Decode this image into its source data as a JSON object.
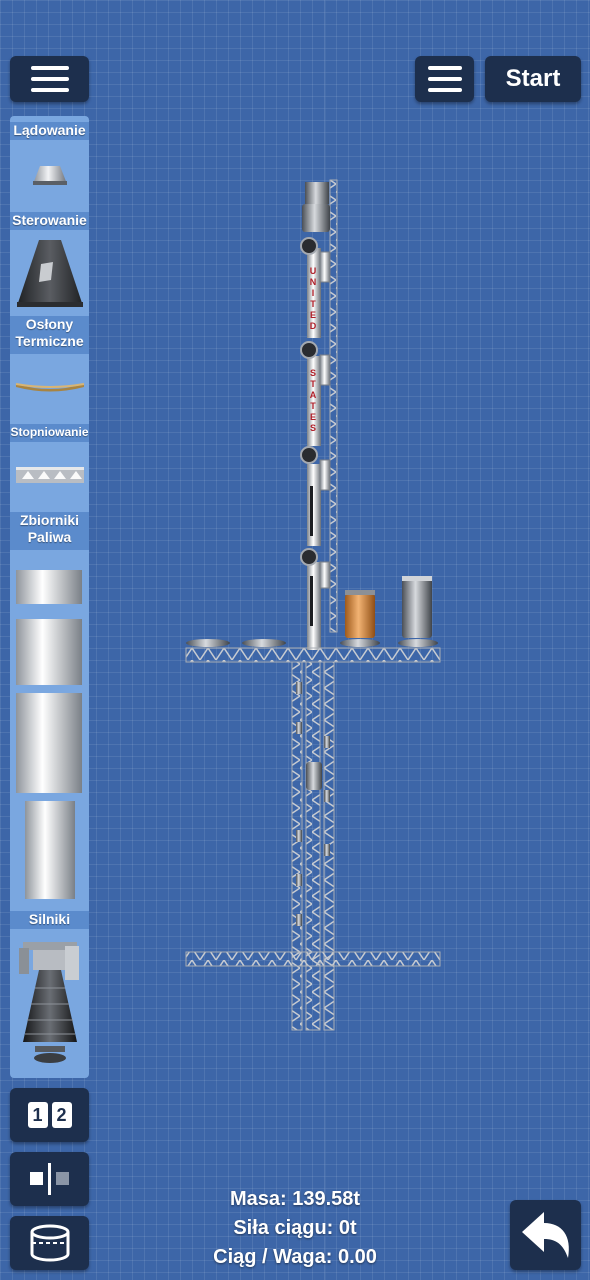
{
  "toolbar": {
    "start_label": "Start"
  },
  "categories": {
    "landing": "Lądowanie",
    "control": "Sterowanie",
    "heat_shields": "Osłony Termiczne",
    "staging": "Stopniowanie",
    "fuel_tanks": "Zbiorniki Paliwa",
    "engines": "Silniki"
  },
  "tool_buttons": {
    "stage_one": "1",
    "stage_two": "2"
  },
  "rocket": {
    "decal_letters_upper": [
      "U",
      "N",
      "I",
      "T",
      "E",
      "D"
    ],
    "decal_letters_lower": [
      "S",
      "T",
      "A",
      "T",
      "E",
      "S"
    ]
  },
  "stats": {
    "mass": "Masa: 139.58t",
    "thrust": "Siła ciągu: 0t",
    "twr": "Ciąg / Waga: 0.00"
  },
  "colors": {
    "background": "#3d66a8",
    "button_bg": "#1d2f4d",
    "panel_bg": "#7aa7e0",
    "category_bg": "#5b8bcc",
    "decal_red": "#b0202a",
    "fuel_orange": "#d98a3a"
  }
}
